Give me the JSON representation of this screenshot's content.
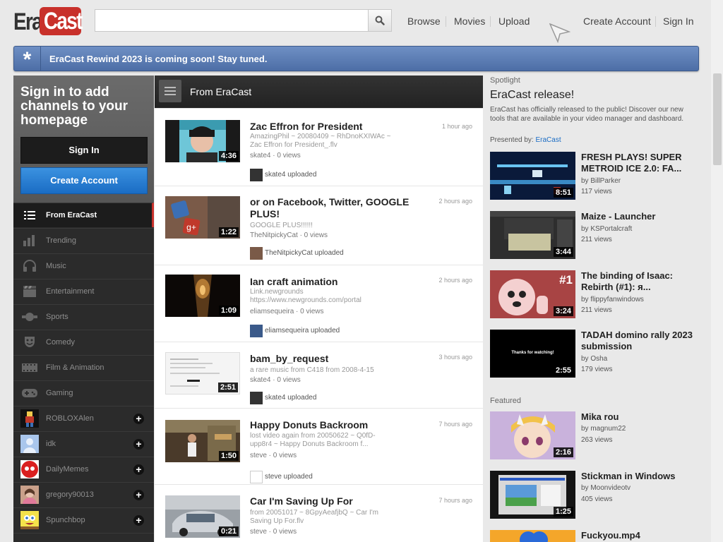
{
  "header": {
    "logo_era": "Era",
    "logo_cast": "Cast",
    "search_placeholder": "",
    "nav": {
      "browse": "Browse",
      "movies": "Movies",
      "upload": "Upload",
      "create_account": "Create Account",
      "sign_in": "Sign In"
    }
  },
  "banner": {
    "message": "EraCast Rewind 2023 is coming soon! Stay tuned."
  },
  "sidebar": {
    "signin_title": "Sign in to add channels to your homepage",
    "signin_button": "Sign In",
    "create_button": "Create Account",
    "categories": [
      {
        "label": "From EraCast",
        "icon": "list-icon",
        "active": true
      },
      {
        "label": "Trending",
        "icon": "bar-chart-icon"
      },
      {
        "label": "Music",
        "icon": "headphones-icon"
      },
      {
        "label": "Entertainment",
        "icon": "clapper-icon"
      },
      {
        "label": "Sports",
        "icon": "sports-icon"
      },
      {
        "label": "Comedy",
        "icon": "mask-icon"
      },
      {
        "label": "Film & Animation",
        "icon": "film-icon"
      },
      {
        "label": "Gaming",
        "icon": "gamepad-icon"
      }
    ],
    "channels": [
      {
        "label": "ROBLOXAlen"
      },
      {
        "label": "idk"
      },
      {
        "label": "DailyMemes"
      },
      {
        "label": "gregory90013"
      },
      {
        "label": "Spunchbop"
      }
    ]
  },
  "feed": {
    "title": "From EraCast",
    "items": [
      {
        "title": "Zac Effron for President",
        "desc": "AmazingPhil ~ 20080409 ~ RhDnoKXIWAc ~ Zac Effron for President_.flv",
        "meta": "skate4 · 0 views",
        "time": "1 hour ago",
        "duration": "4:36",
        "uploader": "skate4 uploaded"
      },
      {
        "title": "or on Facebook, Twitter, GOOGLE PLUS!",
        "desc": "GOOGLE PLUS!!!!!!",
        "meta": "TheNitpickyCat · 0 views",
        "time": "2 hours ago",
        "duration": "1:22",
        "uploader": "TheNitpickyCat uploaded"
      },
      {
        "title": "Ian craft animation",
        "desc": "Link.newgrounds https://www.newgrounds.com/portal",
        "meta": "eliamsequeira · 0 views",
        "time": "2 hours ago",
        "duration": "1:09",
        "uploader": "eliamsequeira uploaded"
      },
      {
        "title": "bam_by_request",
        "desc": "a rare music from C418 from 2008-4-15",
        "meta": "skate4 · 0 views",
        "time": "3 hours ago",
        "duration": "2:51",
        "uploader": "skate4 uploaded"
      },
      {
        "title": "Happy Donuts Backroom",
        "desc": "lost video again from 20050622 ~ Q0fD-upp8r4 ~ Happy Donuts Backroom f...",
        "meta": "steve · 0 views",
        "time": "7 hours ago",
        "duration": "1:50",
        "uploader": "steve uploaded"
      },
      {
        "title": "Car I'm Saving Up For",
        "desc": "from 20051017 ~ 8GpyAeafjbQ ~ Car I'm Saving Up For.flv",
        "meta": "steve · 0 views",
        "time": "7 hours ago",
        "duration": "0:21",
        "uploader": ""
      }
    ]
  },
  "right": {
    "spotlight_label": "Spotlight",
    "spotlight_title": "EraCast release!",
    "spotlight_desc": "EraCast has officially released to the public! Discover our new tools that are available in your video manager and dashboard.",
    "presented_label": "Presented by:",
    "presented_by": "EraCast",
    "spotlight_videos": [
      {
        "title": "FRESH PLAYS! SUPER METROID ICE 2.0: FA...",
        "by": "by BillParker",
        "views": "117 views",
        "duration": "8:51"
      },
      {
        "title": "Maize - Launcher",
        "by": "by KSPortalcraft",
        "views": "211 views",
        "duration": "3:44"
      },
      {
        "title": "The binding of Isaac: Rebirth (#1): я...",
        "by": "by flippyfanwindows",
        "views": "211 views",
        "duration": "3:24",
        "badge": "#1"
      },
      {
        "title": "TADAH domino rally 2023 submission",
        "by": "by Osha",
        "views": "179 views",
        "duration": "2:55",
        "thumb_text": "Thanks for watching!"
      }
    ],
    "featured_label": "Featured",
    "featured_videos": [
      {
        "title": "Mika rou",
        "by": "by magnum22",
        "views": "263 views",
        "duration": "2:16"
      },
      {
        "title": "Stickman in Windows",
        "by": "by Moonvideotv",
        "views": "405 views",
        "duration": "1:25"
      },
      {
        "title": "Fuckyou.mp4"
      }
    ]
  }
}
